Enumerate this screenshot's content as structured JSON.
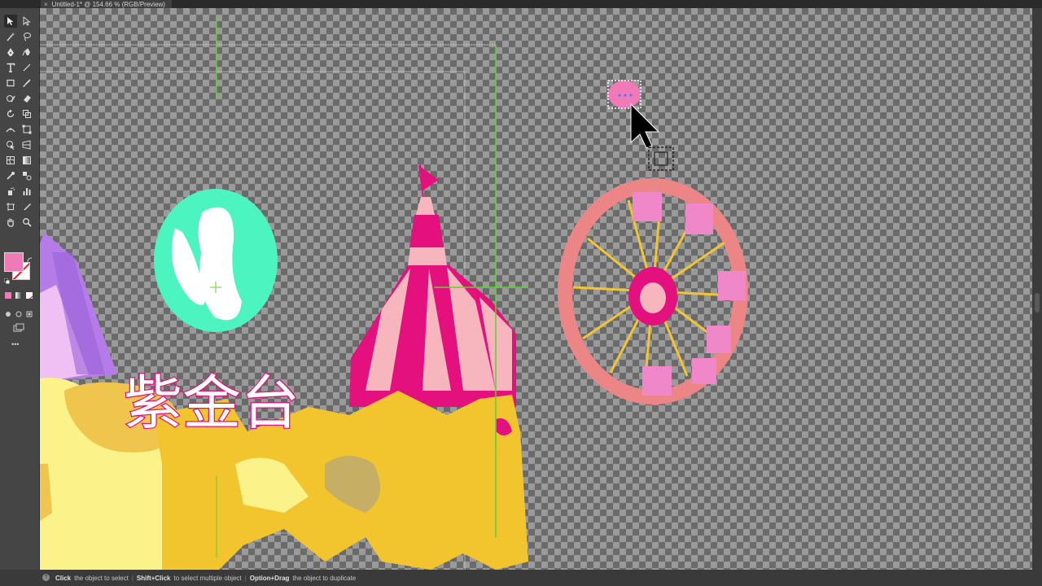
{
  "document_tab": {
    "title": "Untitled-1* @ 154.66 % (RGB/Preview)",
    "close_glyph": "×"
  },
  "artwork": {
    "title_text": "紫金台",
    "colors": {
      "fill": "#f07ab8",
      "stroke": "#ffffff",
      "tent_magenta": "#e4107e",
      "tent_pink": "#f7b5be",
      "balloon_mint": "#4cf5c0",
      "wheel_salmon": "#ec8585",
      "spokes_yellow": "#f2c434",
      "cabin_pink": "#f087c8",
      "ground_gold": "#f2c52e",
      "ground_light": "#fbf28a",
      "tent_lilac": "#b57be8",
      "smart_guide": "#5cd22e"
    }
  },
  "toolbar": {
    "tools": [
      "selection-tool",
      "direct-selection-tool",
      "magic-wand-tool",
      "lasso-tool",
      "pen-tool",
      "curvature-tool",
      "type-tool",
      "line-tool",
      "rectangle-tool",
      "paintbrush-tool",
      "shaper-tool",
      "eraser-tool",
      "rotate-tool",
      "scale-tool",
      "width-tool",
      "free-transform-tool",
      "shape-builder-tool",
      "perspective-tool",
      "mesh-tool",
      "gradient-tool",
      "eyedropper-tool",
      "blend-tool",
      "symbol-sprayer-tool",
      "graph-tool",
      "artboard-tool",
      "slice-tool",
      "hand-tool",
      "zoom-tool"
    ],
    "more_glyph": "•••"
  },
  "status": {
    "hint1_key": "Click",
    "hint1_text": "the object to select",
    "hint2_key": "Shift+Click",
    "hint2_text": "to select multiple object",
    "hint3_key": "Option+Drag",
    "hint3_text": "the object to duplicate",
    "separator": "|"
  }
}
